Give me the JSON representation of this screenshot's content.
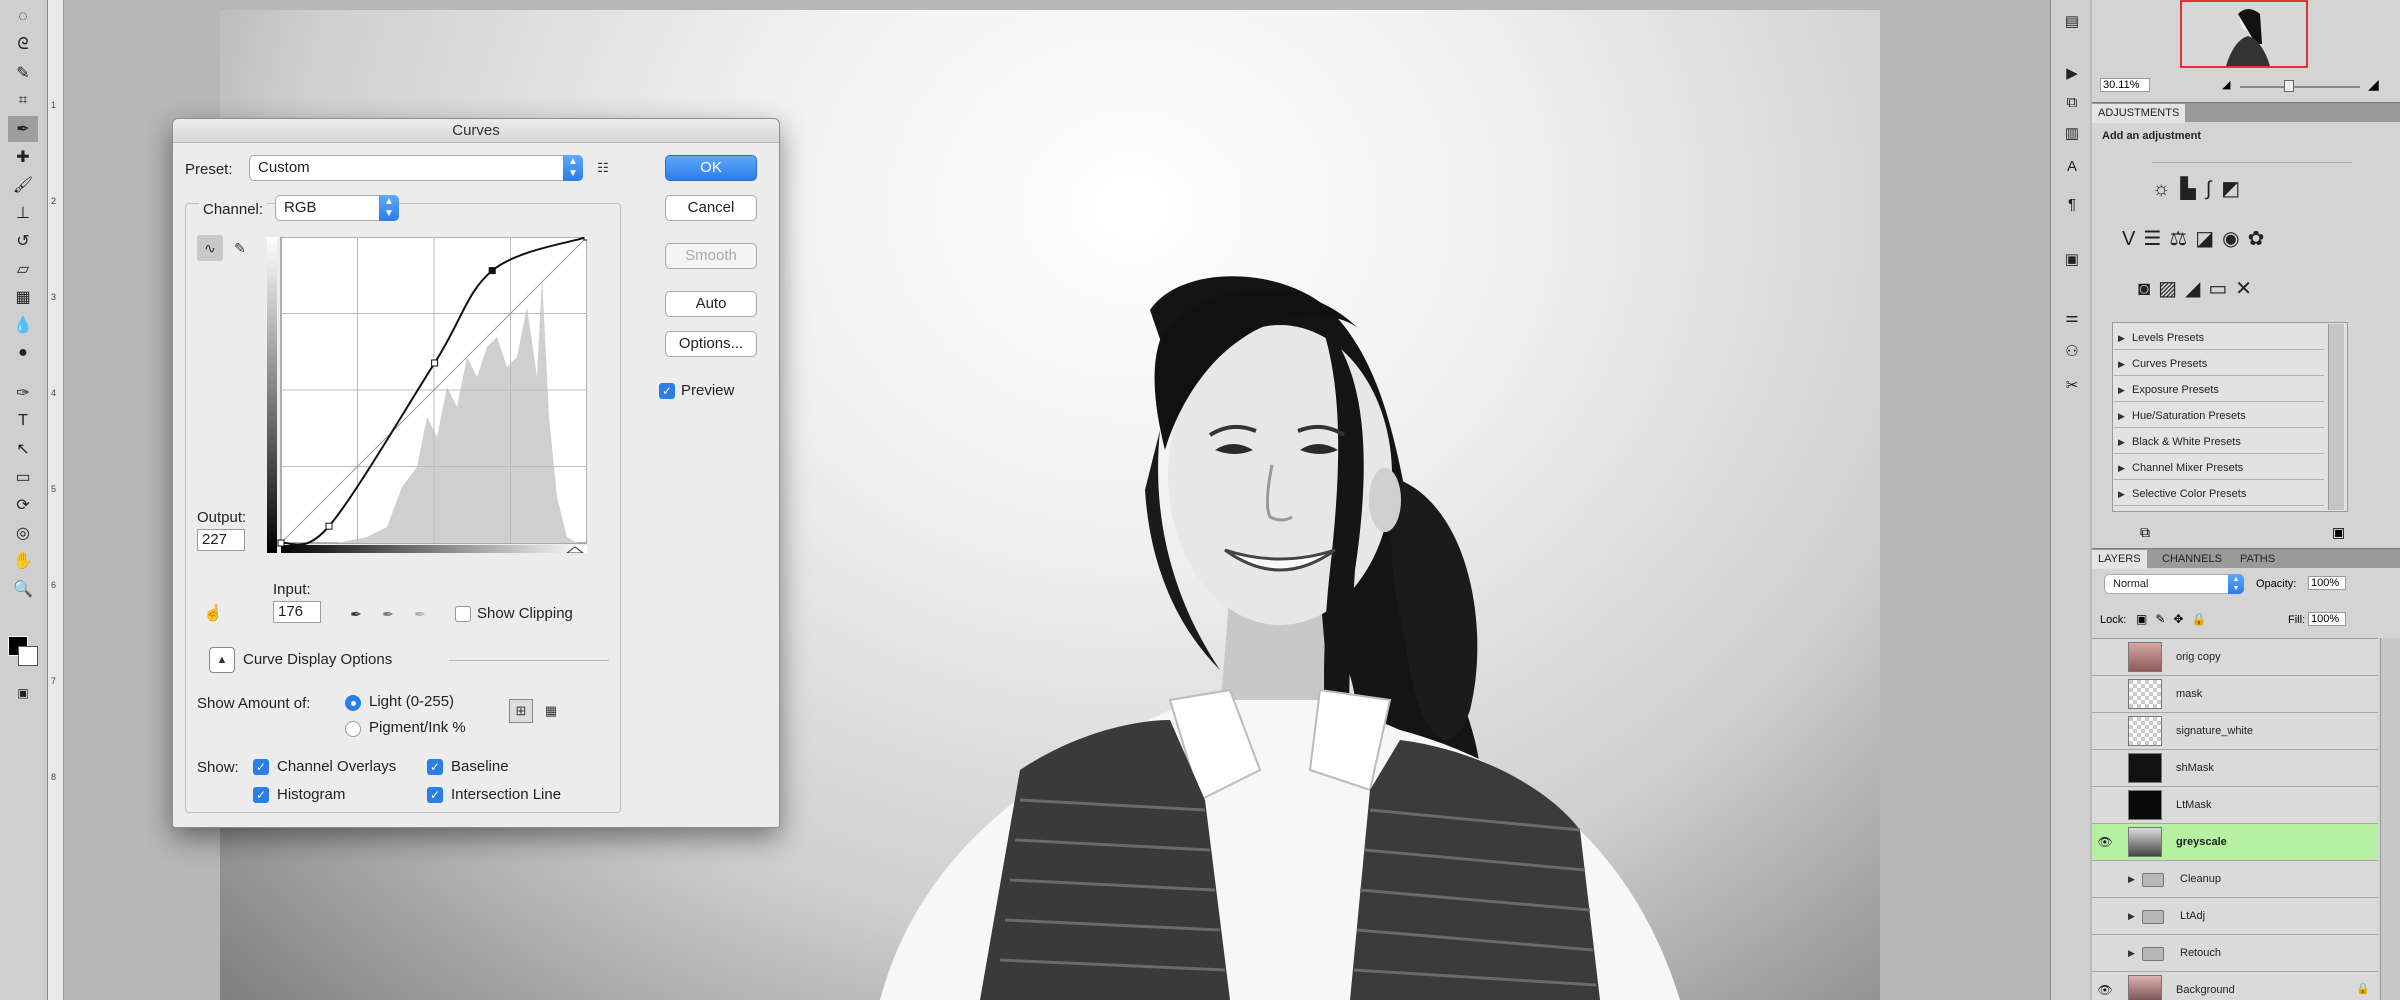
{
  "curves_dialog": {
    "title": "Curves",
    "preset_label": "Preset:",
    "preset_value": "Custom",
    "channel_label": "Channel:",
    "channel_value": "RGB",
    "output_label": "Output:",
    "output_value": "227",
    "input_label": "Input:",
    "input_value": "176",
    "show_clipping_label": "Show Clipping",
    "show_clipping": false,
    "buttons": {
      "ok": "OK",
      "cancel": "Cancel",
      "smooth": "Smooth",
      "auto": "Auto",
      "options": "Options..."
    },
    "preview_label": "Preview",
    "preview_checked": true,
    "curve_display_options": "Curve Display Options",
    "show_amount_label": "Show Amount of:",
    "light_label": "Light  (0-255)",
    "pigment_label": "Pigment/Ink %",
    "show_label": "Show:",
    "channel_overlays": "Channel Overlays",
    "baseline": "Baseline",
    "histogram": "Histogram",
    "intersection_line": "Intersection Line",
    "curve_points": [
      [
        0,
        0
      ],
      [
        40,
        14
      ],
      [
        128,
        150
      ],
      [
        176,
        227
      ],
      [
        255,
        255
      ]
    ]
  },
  "navigator": {
    "zoom": "30.11%"
  },
  "adjustments": {
    "tab": "ADJUSTMENTS",
    "heading": "Add an adjustment",
    "presets": [
      "Levels Presets",
      "Curves Presets",
      "Exposure Presets",
      "Hue/Saturation Presets",
      "Black & White Presets",
      "Channel Mixer Presets",
      "Selective Color Presets"
    ]
  },
  "layers_panel": {
    "tabs": [
      "LAYERS",
      "CHANNELS",
      "PATHS"
    ],
    "blend_mode": "Normal",
    "opacity_label": "Opacity:",
    "opacity": "100%",
    "lock_label": "Lock:",
    "fill_label": "Fill:",
    "fill": "100%",
    "layers": [
      {
        "name": "orig copy",
        "visible": false,
        "kind": "layer"
      },
      {
        "name": "mask",
        "visible": false,
        "kind": "layer"
      },
      {
        "name": "signature_white",
        "visible": false,
        "kind": "layer"
      },
      {
        "name": "shMask",
        "visible": false,
        "kind": "layer"
      },
      {
        "name": "LtMask",
        "visible": false,
        "kind": "layer"
      },
      {
        "name": "greyscale",
        "visible": true,
        "kind": "layer",
        "selected": true
      },
      {
        "name": "Cleanup",
        "visible": false,
        "kind": "group"
      },
      {
        "name": "LtAdj",
        "visible": false,
        "kind": "group"
      },
      {
        "name": "Retouch",
        "visible": false,
        "kind": "group"
      },
      {
        "name": "Background",
        "visible": true,
        "kind": "layer"
      }
    ]
  },
  "colors": {
    "accent": "#2b7de8",
    "selected_layer": "#b7f0a2"
  }
}
